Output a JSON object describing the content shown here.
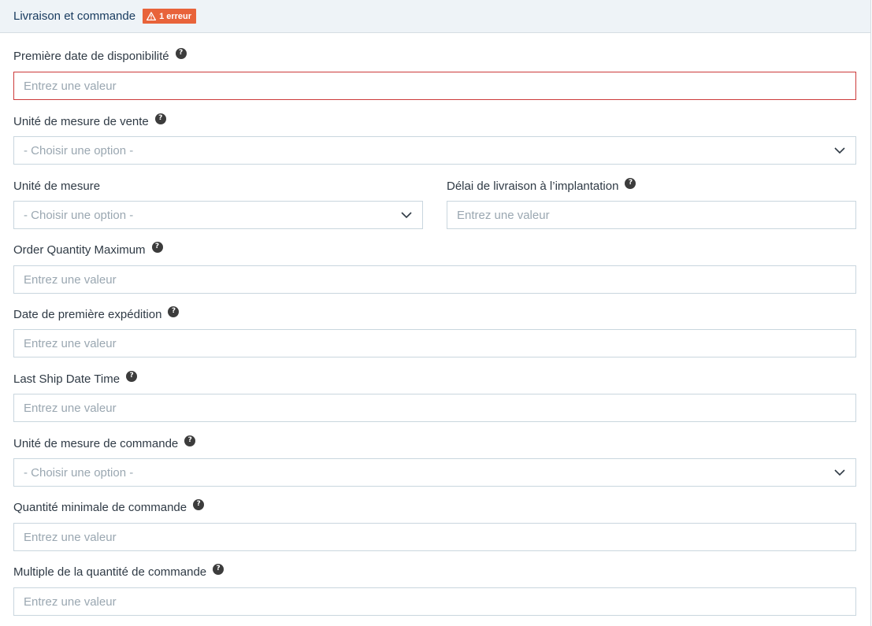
{
  "section": {
    "title": "Livraison et commande",
    "error_badge": "1 erreur"
  },
  "fields": {
    "first_available_date": {
      "label": "Première date de disponibilité",
      "placeholder": "Entrez une valeur"
    },
    "sales_uom": {
      "label": "Unité de mesure de vente",
      "value": "- Choisir une option -"
    },
    "uom": {
      "label": "Unité de mesure",
      "value": "- Choisir une option -"
    },
    "lead_time": {
      "label": "Délai de livraison à l’implantation",
      "placeholder": "Entrez une valeur"
    },
    "order_qty_max": {
      "label": "Order Quantity Maximum",
      "placeholder": "Entrez une valeur"
    },
    "first_ship_date": {
      "label": "Date de première expédition",
      "placeholder": "Entrez une valeur"
    },
    "last_ship_date": {
      "label": "Last Ship Date Time",
      "placeholder": "Entrez une valeur"
    },
    "order_uom": {
      "label": "Unité de mesure de commande",
      "value": "- Choisir une option -"
    },
    "min_order_qty": {
      "label": "Quantité minimale de commande",
      "placeholder": "Entrez une valeur"
    },
    "order_qty_multiple": {
      "label": "Multiple de la quantité de commande",
      "placeholder": "Entrez une valeur"
    }
  },
  "icons": {
    "help": "question-icon",
    "warning": "warning-icon",
    "dropdown": "chevron-down-icon"
  },
  "colors": {
    "error": "#e8633a",
    "error_border": "#cc3a3a",
    "header_bg": "#eef3f7",
    "title": "#173a5e"
  }
}
